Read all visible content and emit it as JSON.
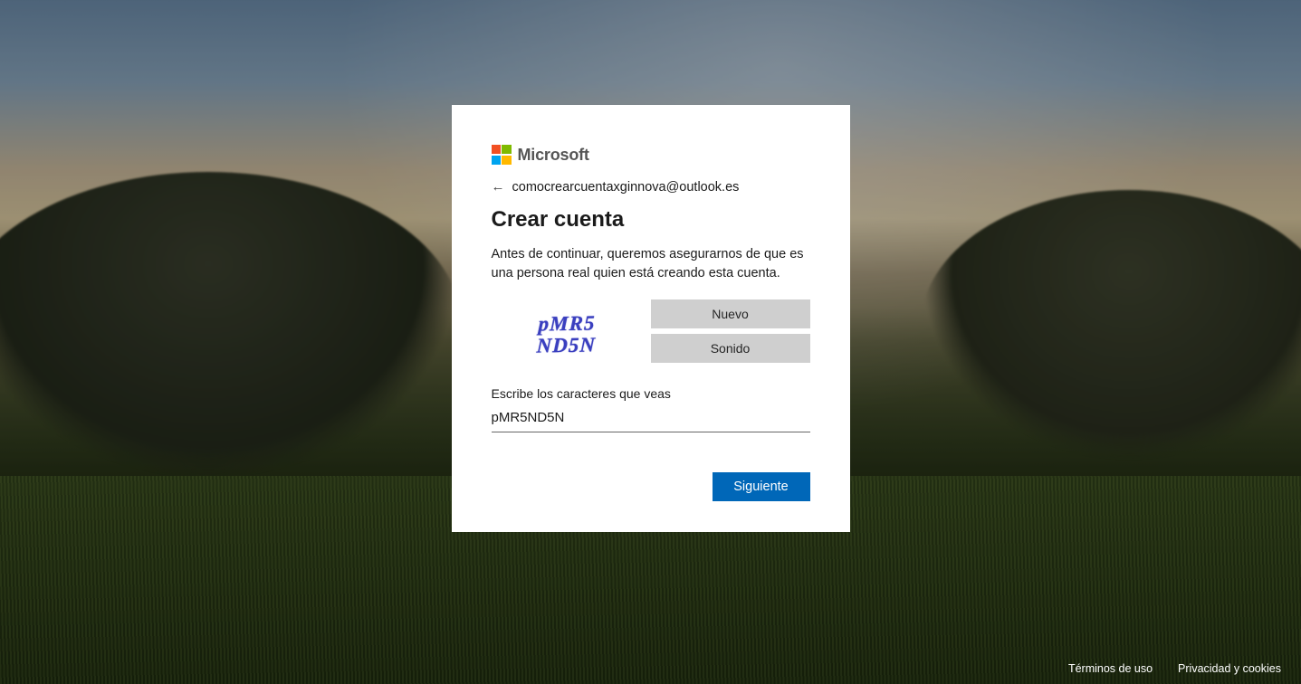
{
  "brand": {
    "name": "Microsoft"
  },
  "account": {
    "email": "comocrearcuentaxginnova@outlook.es"
  },
  "heading": "Crear cuenta",
  "subtitle": "Antes de continuar, queremos asegurarnos de que es una persona real quien está creando esta cuenta.",
  "captcha": {
    "image_text": "pMR5\nND5N",
    "new_label": "Nuevo",
    "audio_label": "Sonido",
    "field_label": "Escribe los caracteres que veas",
    "input_value": "pMR5ND5N"
  },
  "buttons": {
    "next": "Siguiente"
  },
  "footer": {
    "terms": "Términos de uso",
    "privacy": "Privacidad y cookies"
  }
}
